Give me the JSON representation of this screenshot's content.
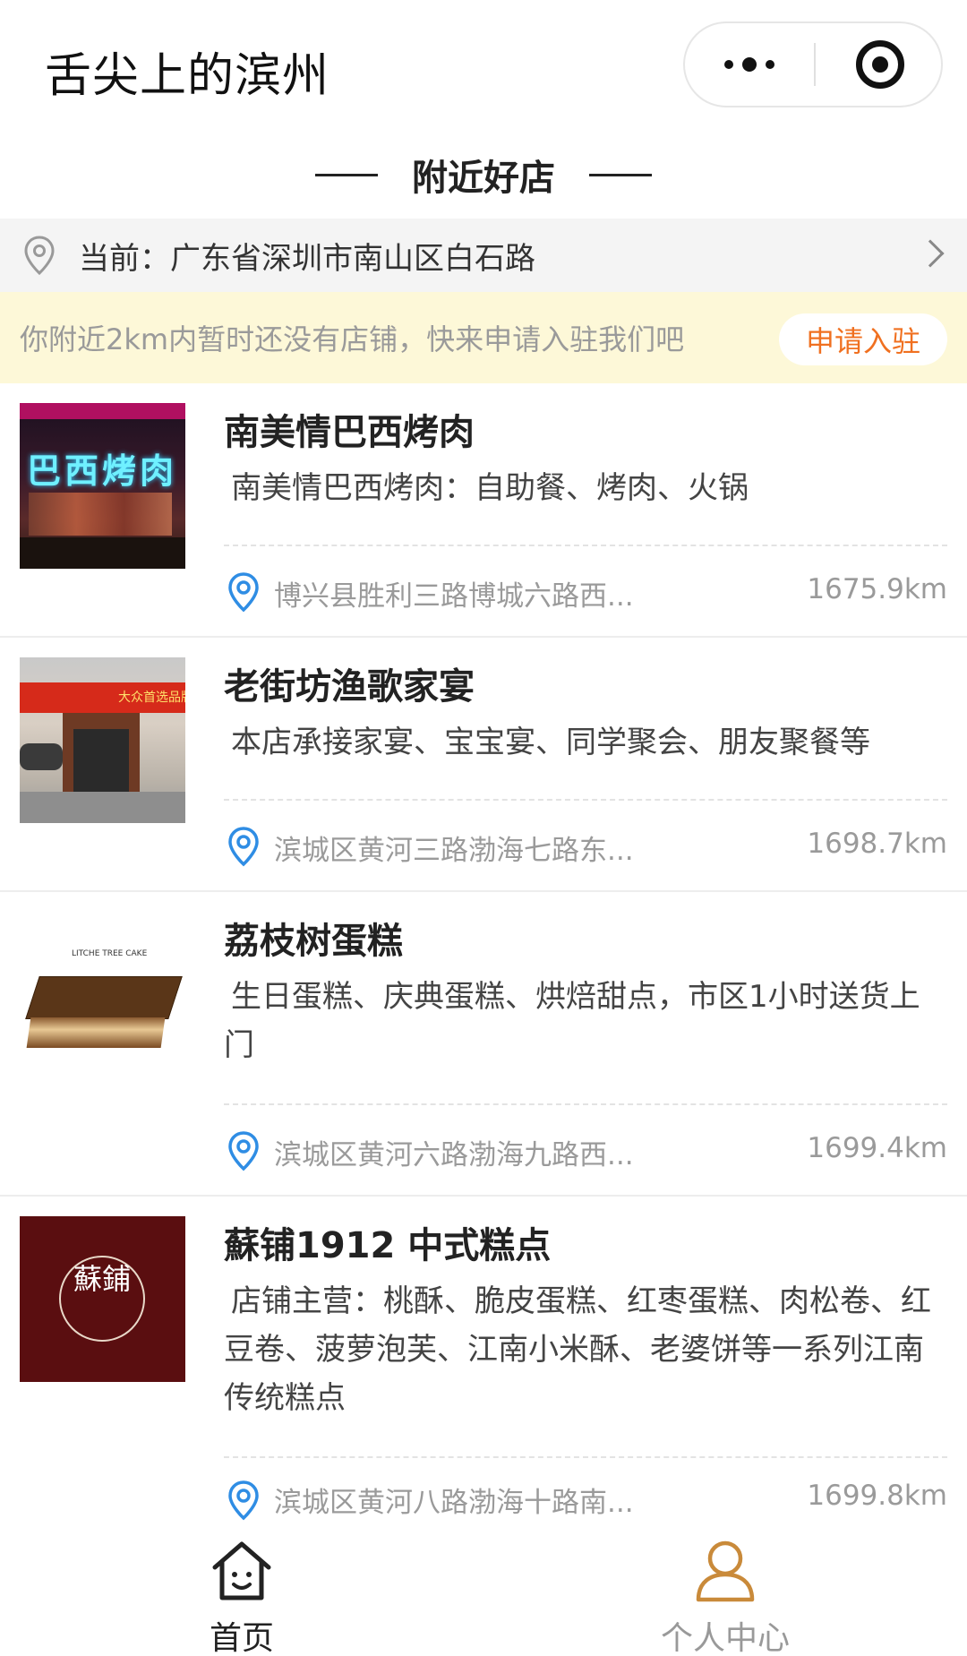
{
  "app": {
    "title": "舌尖上的滨州"
  },
  "section": {
    "title": "附近好店"
  },
  "location": {
    "text": "当前：广东省深圳市南山区白石路"
  },
  "notice": {
    "text": "你附近2km内暂时还没有店铺，快来申请入驻我们吧",
    "apply_label": "申请入驻"
  },
  "stores": [
    {
      "name": "南美情巴西烤肉",
      "desc": "南美情巴西烤肉：自助餐、烤肉、火锅",
      "address": "博兴县胜利三路博城六路西...",
      "distance": "1675.9km",
      "thumb_text": "巴西烤肉"
    },
    {
      "name": "老街坊渔歌家宴",
      "desc": "本店承接家宴、宝宝宴、同学聚会、朋友聚餐等",
      "address": "滨城区黄河三路渤海七路东...",
      "distance": "1698.7km",
      "thumb_text": "大众首选品牌"
    },
    {
      "name": "荔枝树蛋糕",
      "desc": "生日蛋糕、庆典蛋糕、烘焙甜点，市区1小时送货上门",
      "address": "滨城区黄河六路渤海九路西...",
      "distance": "1699.4km",
      "thumb_text": "LITCHE TREE CAKE"
    },
    {
      "name": "蘇铺1912 中式糕点",
      "desc": "店铺主营：桃酥、脆皮蛋糕、红枣蛋糕、肉松卷、红豆卷、菠萝泡芙、江南小米酥、老婆饼等一系列江南传统糕点",
      "address": "滨城区黄河八路渤海十路南...",
      "distance": "1699.8km",
      "thumb_text": "蘇鋪"
    }
  ],
  "tabs": {
    "home": "首页",
    "profile": "个人中心"
  },
  "colors": {
    "accent": "#f07020",
    "notice_bg": "#fdf8d8",
    "pin_blue": "#2f8de4",
    "profile_icon": "#c98a3a"
  }
}
